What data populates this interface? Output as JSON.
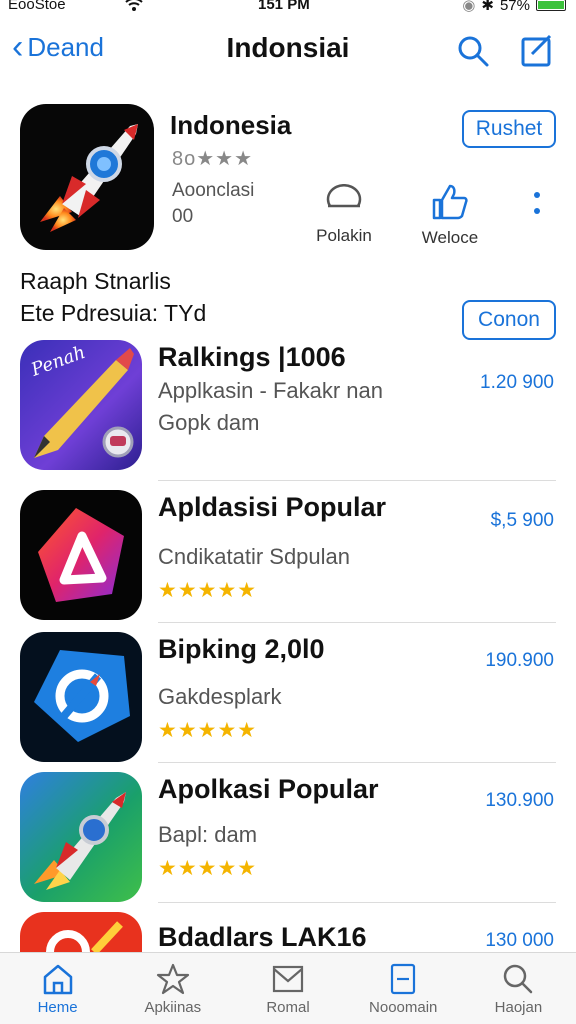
{
  "status_bar": {
    "carrier": "EooStoe",
    "time": "151 PM",
    "battery": "57%"
  },
  "nav": {
    "back_label": "Deand",
    "title": "Indonsiai"
  },
  "featured": {
    "name": "Indonesia",
    "rating_text": "8o★★★",
    "subtitle_1": "Aoonclasi",
    "subtitle_2": "00",
    "button": "Rushet",
    "action_1": "Polakin",
    "action_2": "Weloce"
  },
  "section": {
    "line_1": "Raaph Stnarlis",
    "line_2": "Ete Pdresuia: TYd",
    "button": "Conon"
  },
  "apps": [
    {
      "name": "Ralkings |1006",
      "sub_1": "Applkasin - Fakakr nan",
      "sub_2": "Gopk dam",
      "price": "1.20 900",
      "stars": ""
    },
    {
      "name": "Apldasisi Popular",
      "sub_1": "Cndikatatir Sdpulan",
      "sub_2": "",
      "price": "$,5 900",
      "stars": "★★★★★"
    },
    {
      "name": "Bipking 2,0l0",
      "sub_1": "Gakdesplark",
      "sub_2": "",
      "price": "190.900",
      "stars": "★★★★★"
    },
    {
      "name": "Apolkasi Popular",
      "sub_1": "Bapl: dam",
      "sub_2": "",
      "price": "130.900",
      "stars": "★★★★★"
    },
    {
      "name": "Bdadlars LAK16",
      "sub_1": "",
      "sub_2": "",
      "price": "130 000",
      "stars": ""
    }
  ],
  "tabs": [
    {
      "label": "Heme",
      "icon": "home-icon"
    },
    {
      "label": "Apkiinas",
      "icon": "star-icon"
    },
    {
      "label": "Romal",
      "icon": "mail-icon"
    },
    {
      "label": "Nooomain",
      "icon": "minus-box-icon"
    },
    {
      "label": "Haojan",
      "icon": "search-icon"
    }
  ],
  "colors": {
    "accent": "#1a73d9",
    "star": "#f4b400",
    "battery": "#3cc23c"
  }
}
